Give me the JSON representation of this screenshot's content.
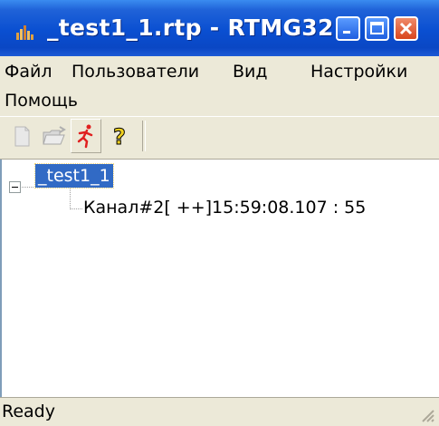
{
  "window": {
    "title": "_test1_1.rtp - RTMG32"
  },
  "menu": {
    "items": [
      "Файл",
      "Пользователи",
      "Вид",
      "Настройки",
      "Помощь"
    ]
  },
  "toolbar": {
    "buttons": [
      "new-file-icon",
      "open-folder-icon",
      "running-man-icon",
      "help-question-icon"
    ]
  },
  "tree": {
    "root_label": "_test1_1",
    "child_label": "Канал#2[ ++]15:59:08.107 : 55"
  },
  "status": {
    "text": "Ready"
  },
  "colors": {
    "titlebar": "#0a4fd1",
    "selection": "#316ac5",
    "close_button": "#d9451d",
    "chrome": "#ece9d8"
  }
}
